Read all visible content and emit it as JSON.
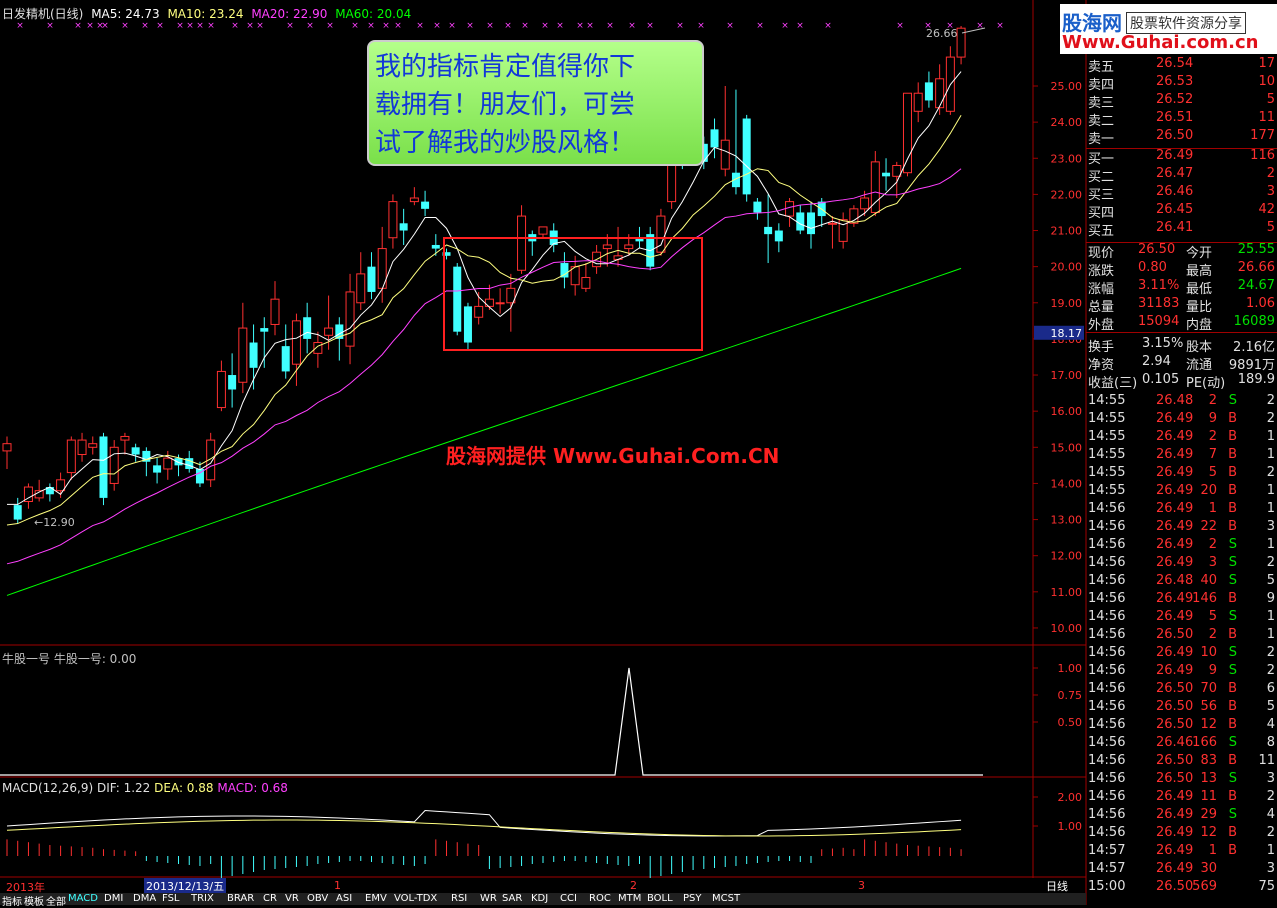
{
  "header": {
    "title": "日发精机(日线)",
    "ma5": "MA5: 24.73",
    "ma10": "MA10: 23.24",
    "ma20": "MA20: 22.90",
    "ma60": "MA60: 20.04"
  },
  "colors": {
    "ma5": "#ffffff",
    "ma10": "#ffff80",
    "ma20": "#ff40ff",
    "ma60": "#00ff00",
    "up": "#ff3030",
    "down": "#40ffff"
  },
  "callout": {
    "line1": "我的指标肯定值得你下",
    "line2": "载拥有！朋友们，可尝",
    "line3": "试了解我的炒股风格！"
  },
  "watermark": "股海网提供 Www.Guhai.Com.CN",
  "logo": {
    "name": "股海网",
    "slogan": "股票软件资源分享",
    "url": "Www.Guhai.com.cn"
  },
  "price_axis": [
    "25.00",
    "24.00",
    "23.00",
    "22.00",
    "21.00",
    "20.00",
    "19.00",
    "18.00",
    "17.00",
    "16.00",
    "15.00",
    "14.00",
    "13.00",
    "12.00",
    "11.00",
    "10.00"
  ],
  "price_marker": "18.17",
  "high_label": "26.66",
  "low_label": "12.90",
  "indicator1": {
    "title": "牛股一号  牛股一号: 0.00",
    "axis": [
      "1.00",
      "0.75",
      "0.50"
    ]
  },
  "macd": {
    "title": "MACD(12,26,9)",
    "dif": "DIF: 1.22",
    "dea": "DEA: 0.88",
    "macd": "MACD: 0.68",
    "axis": [
      "2.00",
      "1.00"
    ]
  },
  "date_axis": {
    "year": "2013年",
    "cursor_date": "2013/12/13/五",
    "months": [
      "1",
      "2",
      "3"
    ],
    "period": "日线"
  },
  "bottom_tabs": [
    "指标",
    "模板",
    "全部",
    "MACD",
    "DMI",
    "DMA",
    "FSL",
    "TRIX",
    "BRAR",
    "CR",
    "VR",
    "OBV",
    "ASI",
    "EMV",
    "VOL-TDX",
    "RSI",
    "WR",
    "SAR",
    "KDJ",
    "CCI",
    "ROC",
    "MTM",
    "BOLL",
    "PSY",
    "MCST"
  ],
  "quote": {
    "asks": [
      {
        "label": "卖五",
        "price": "26.54",
        "vol": "17"
      },
      {
        "label": "卖四",
        "price": "26.53",
        "vol": "10"
      },
      {
        "label": "卖三",
        "price": "26.52",
        "vol": "5"
      },
      {
        "label": "卖二",
        "price": "26.51",
        "vol": "11"
      },
      {
        "label": "卖一",
        "price": "26.50",
        "vol": "177"
      }
    ],
    "bids": [
      {
        "label": "买一",
        "price": "26.49",
        "vol": "116"
      },
      {
        "label": "买二",
        "price": "26.47",
        "vol": "2"
      },
      {
        "label": "买三",
        "price": "26.46",
        "vol": "3"
      },
      {
        "label": "买四",
        "price": "26.45",
        "vol": "42"
      },
      {
        "label": "买五",
        "price": "26.41",
        "vol": "5"
      }
    ],
    "stats": [
      {
        "l1": "现价",
        "v1": "26.50",
        "l2": "今开",
        "v2": "25.55"
      },
      {
        "l1": "涨跌",
        "v1": "0.80",
        "l2": "最高",
        "v2": "26.66"
      },
      {
        "l1": "涨幅",
        "v1": "3.11%",
        "l2": "最低",
        "v2": "24.67"
      },
      {
        "l1": "总量",
        "v1": "31183",
        "l2": "量比",
        "v2": "1.06"
      },
      {
        "l1": "外盘",
        "v1": "15094",
        "l2": "内盘",
        "v2": "16089"
      }
    ],
    "fin": [
      {
        "l1": "换手",
        "v1": "3.15%",
        "l2": "股本",
        "v2": "2.16亿"
      },
      {
        "l1": "净资",
        "v1": "2.94",
        "l2": "流通",
        "v2": "9891万"
      },
      {
        "l1": "收益(三)",
        "v1": "0.105",
        "l2": "PE(动)",
        "v2": "189.9"
      }
    ],
    "ticks": [
      {
        "t": "14:55",
        "p": "26.48",
        "v": "2",
        "s": "S",
        "n": "2"
      },
      {
        "t": "14:55",
        "p": "26.49",
        "v": "9",
        "s": "B",
        "n": "2"
      },
      {
        "t": "14:55",
        "p": "26.49",
        "v": "2",
        "s": "B",
        "n": "1"
      },
      {
        "t": "14:55",
        "p": "26.49",
        "v": "7",
        "s": "B",
        "n": "1"
      },
      {
        "t": "14:55",
        "p": "26.49",
        "v": "5",
        "s": "B",
        "n": "2"
      },
      {
        "t": "14:55",
        "p": "26.49",
        "v": "20",
        "s": "B",
        "n": "1"
      },
      {
        "t": "14:56",
        "p": "26.49",
        "v": "1",
        "s": "B",
        "n": "1"
      },
      {
        "t": "14:56",
        "p": "26.49",
        "v": "22",
        "s": "B",
        "n": "3"
      },
      {
        "t": "14:56",
        "p": "26.49",
        "v": "2",
        "s": "S",
        "n": "1"
      },
      {
        "t": "14:56",
        "p": "26.49",
        "v": "3",
        "s": "S",
        "n": "2"
      },
      {
        "t": "14:56",
        "p": "26.48",
        "v": "40",
        "s": "S",
        "n": "5"
      },
      {
        "t": "14:56",
        "p": "26.49",
        "v": "146",
        "s": "B",
        "n": "9"
      },
      {
        "t": "14:56",
        "p": "26.49",
        "v": "5",
        "s": "S",
        "n": "1"
      },
      {
        "t": "14:56",
        "p": "26.50",
        "v": "2",
        "s": "B",
        "n": "1"
      },
      {
        "t": "14:56",
        "p": "26.49",
        "v": "10",
        "s": "S",
        "n": "2"
      },
      {
        "t": "14:56",
        "p": "26.49",
        "v": "9",
        "s": "S",
        "n": "2"
      },
      {
        "t": "14:56",
        "p": "26.50",
        "v": "70",
        "s": "B",
        "n": "6"
      },
      {
        "t": "14:56",
        "p": "26.50",
        "v": "56",
        "s": "B",
        "n": "5"
      },
      {
        "t": "14:56",
        "p": "26.50",
        "v": "12",
        "s": "B",
        "n": "4"
      },
      {
        "t": "14:56",
        "p": "26.46",
        "v": "166",
        "s": "S",
        "n": "8"
      },
      {
        "t": "14:56",
        "p": "26.50",
        "v": "83",
        "s": "B",
        "n": "11"
      },
      {
        "t": "14:56",
        "p": "26.50",
        "v": "13",
        "s": "S",
        "n": "3"
      },
      {
        "t": "14:56",
        "p": "26.49",
        "v": "11",
        "s": "B",
        "n": "2"
      },
      {
        "t": "14:56",
        "p": "26.49",
        "v": "29",
        "s": "S",
        "n": "4"
      },
      {
        "t": "14:56",
        "p": "26.49",
        "v": "12",
        "s": "B",
        "n": "2"
      },
      {
        "t": "14:57",
        "p": "26.49",
        "v": "1",
        "s": "B",
        "n": "1"
      },
      {
        "t": "14:57",
        "p": "26.49",
        "v": "30",
        "s": "",
        "n": "3"
      },
      {
        "t": "15:00",
        "p": "26.50",
        "v": "569",
        "s": "",
        "n": "75"
      }
    ]
  }
}
